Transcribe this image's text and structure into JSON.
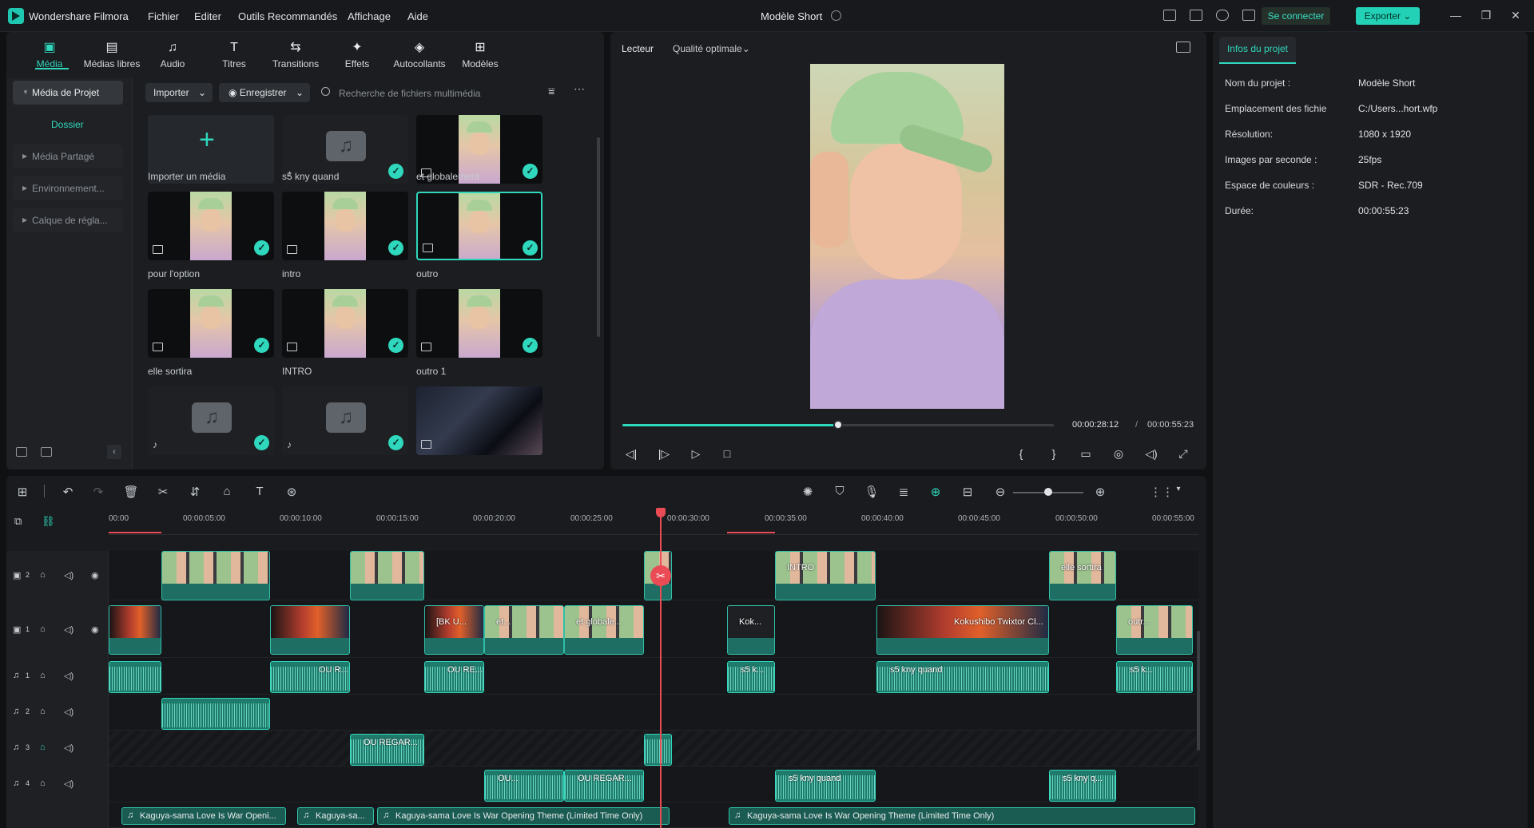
{
  "app": {
    "name": "Wondershare Filmora",
    "project_title": "Modèle Short"
  },
  "menu": [
    "Fichier",
    "Editer",
    "Outils Recommandés",
    "Affichage",
    "Aide"
  ],
  "titlebar": {
    "connect": "Se connecter",
    "export": "Exporter"
  },
  "media_tabs": [
    "Média",
    "Médias libres",
    "Audio",
    "Titres",
    "Transitions",
    "Effets",
    "Autocollants",
    "Modèles"
  ],
  "sidebar": {
    "project_media": "Média de Projet",
    "folder": "Dossier",
    "shared": "Média Partagé",
    "environment": "Environnement...",
    "adjustment": "Calque de régla..."
  },
  "media_toolbar": {
    "import": "Importer",
    "record": "Enregistrer",
    "search_placeholder": "Recherche de fichiers multimédia"
  },
  "media_items": [
    {
      "label": "Importer un média"
    },
    {
      "label": "s5 kny quand"
    },
    {
      "label": "et globalement"
    },
    {
      "label": "pour l'option"
    },
    {
      "label": "intro"
    },
    {
      "label": "outro"
    },
    {
      "label": "elle sortira"
    },
    {
      "label": "INTRO"
    },
    {
      "label": "outro 1"
    }
  ],
  "player": {
    "tab": "Lecteur",
    "quality": "Qualité optimale",
    "current": "00:00:28:12",
    "separator": "/",
    "total": "00:00:55:23",
    "progress": 0.5
  },
  "props": {
    "tab": "Infos du projet",
    "rows": [
      {
        "k": "Nom du projet :",
        "v": "Modèle Short"
      },
      {
        "k": "Emplacement des fichie",
        "v": "C:/Users...hort.wfp"
      },
      {
        "k": "Résolution:",
        "v": "1080 x 1920"
      },
      {
        "k": "Images par seconde :",
        "v": "25fps"
      },
      {
        "k": "Espace de couleurs :",
        "v": "SDR - Rec.709"
      },
      {
        "k": "Durée:",
        "v": "00:00:55:23"
      }
    ]
  },
  "ruler": [
    "00:00",
    "00:00:05:00",
    "00:00:10:00",
    "00:00:15:00",
    "00:00:20:00",
    "00:00:25:00",
    "00:00:30:00",
    "00:00:35:00",
    "00:00:40:00",
    "00:00:45:00",
    "00:00:50:00",
    "00:00:55:00"
  ],
  "track_labels": {
    "v2": "2",
    "v1": "1",
    "a1": "1",
    "a2": "2",
    "a3": "3",
    "a4": "4"
  },
  "clip_titles": {
    "v2_intro": "INTRO",
    "v2_elle": "elle sortira",
    "v1_bk": "[BK U...",
    "v1_et": "et...",
    "v1_etglob": "et globale...",
    "v1_kok": "Kok...",
    "v1_kok2": "Kokushibo Twixtor Cl...",
    "v1_outro": "outr...",
    "a1_ou": "OU R...",
    "a1_oure": "OU RE...",
    "a1_s5k": "s5 k...",
    "a1_s5kny": "s5 kny quand",
    "a1_s5k2": "s5 k...",
    "a3_ou": "OU REGAR...",
    "a4_ou": "OU...",
    "a4_ouregar": "OU REGAR...",
    "a4_s5": "s5 kny quand",
    "a4_s5q": "s5 kny q...",
    "m1": "Kaguya-sama Love Is War  Openi...",
    "m2": "Kaguya-sa...",
    "m3": "Kaguya-sama Love Is War  Opening Theme (Limited Time Only)",
    "m4": "Kaguya-sama Love Is War  Opening Theme (Limited Time Only)"
  }
}
